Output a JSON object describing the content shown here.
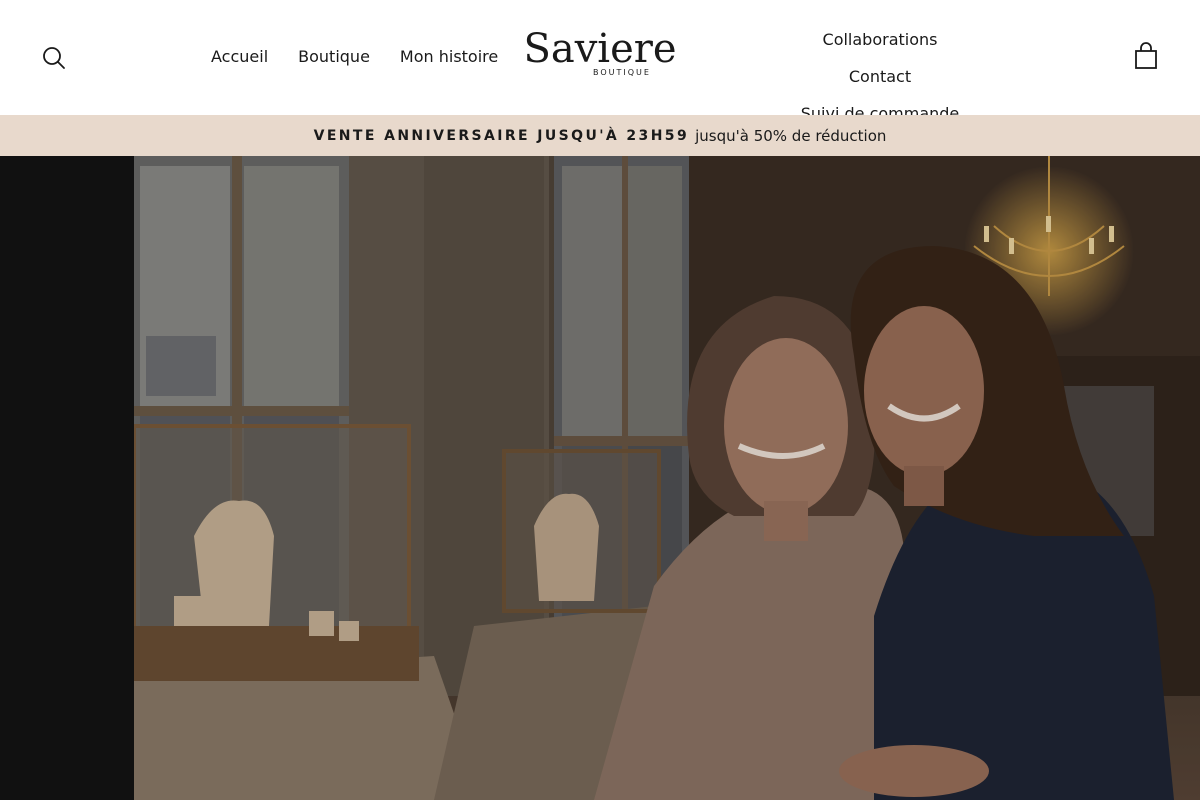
{
  "header": {
    "nav_left": [
      "Accueil",
      "Boutique",
      "Mon histoire"
    ],
    "logo": {
      "word": "Saviere",
      "sub": "BOUTIQUE"
    },
    "nav_right": [
      "Collaborations",
      "Contact",
      "Suivi de commande"
    ],
    "icons": {
      "search": "search-icon",
      "cart": "shopping-bag-icon"
    }
  },
  "announcement": {
    "strong": "VENTE ANNIVERSAIRE JUSQU'À 23H59",
    "light": "jusqu'à 50% de réduction"
  },
  "colors": {
    "header_bg": "#ffffff",
    "announcement_bg": "#e8d9cc",
    "text": "#1a1a1a",
    "hero_side": "#111111"
  }
}
